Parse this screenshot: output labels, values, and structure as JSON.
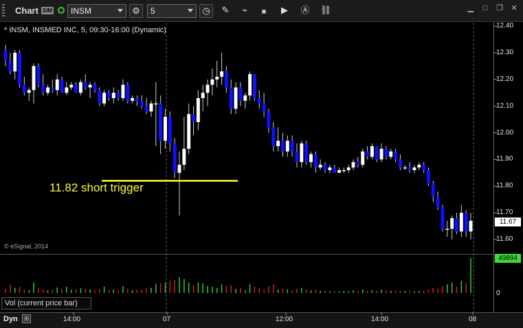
{
  "toolbar": {
    "title": "Chart",
    "sim_badge": "SIM",
    "symbol": "INSM",
    "interval": "5"
  },
  "chart_header": "* INSM, INSMED INC, 5, 09:30-16:00 (Dynamic)",
  "copyright": "© eSignal, 2014",
  "annotation": "11.82 short trigger",
  "volume_label": "Vol (current price bar)",
  "footer": {
    "dyn": "Dyn"
  },
  "current_price": "11.67",
  "current_volume": "49894",
  "volume_zero": "0",
  "colors": {
    "up": "#ffffff",
    "down": "#1010ff",
    "trigger": "#ffff33",
    "vol_up": "#33cc33",
    "vol_down": "#cc2222"
  },
  "chart_data": {
    "type": "candlestick",
    "symbol": "INSM",
    "y_ticks": [
      "12.40",
      "12.30",
      "12.20",
      "12.10",
      "12.00",
      "11.90",
      "11.80",
      "11.70",
      "11.60"
    ],
    "ylim": [
      11.56,
      12.42
    ],
    "x_ticks": [
      "14:00",
      "07",
      "12:00",
      "14:00",
      "08"
    ],
    "trigger_level": 11.82,
    "bars": [
      [
        12.31,
        12.33,
        12.25,
        12.27
      ],
      [
        12.27,
        12.3,
        12.22,
        12.23
      ],
      [
        12.23,
        12.31,
        12.2,
        12.3
      ],
      [
        12.3,
        12.31,
        12.17,
        12.18
      ],
      [
        12.18,
        12.21,
        12.14,
        12.15
      ],
      [
        12.15,
        12.17,
        12.12,
        12.16
      ],
      [
        12.16,
        12.26,
        12.11,
        12.25
      ],
      [
        12.25,
        12.26,
        12.17,
        12.18
      ],
      [
        12.18,
        12.22,
        12.14,
        12.15
      ],
      [
        12.15,
        12.18,
        12.14,
        12.17
      ],
      [
        12.17,
        12.2,
        12.15,
        12.16
      ],
      [
        12.16,
        12.22,
        12.14,
        12.2
      ],
      [
        12.2,
        12.21,
        12.15,
        12.15
      ],
      [
        12.15,
        12.19,
        12.14,
        12.17
      ],
      [
        12.17,
        12.19,
        12.16,
        12.18
      ],
      [
        12.18,
        12.19,
        12.15,
        12.15
      ],
      [
        12.15,
        12.2,
        12.14,
        12.19
      ],
      [
        12.19,
        12.22,
        12.16,
        12.17
      ],
      [
        12.17,
        12.19,
        12.13,
        12.18
      ],
      [
        12.18,
        12.19,
        12.15,
        12.16
      ],
      [
        12.16,
        12.17,
        12.1,
        12.11
      ],
      [
        12.11,
        12.16,
        12.1,
        12.15
      ],
      [
        12.15,
        12.16,
        12.12,
        12.13
      ],
      [
        12.13,
        12.17,
        12.11,
        12.15
      ],
      [
        12.15,
        12.16,
        12.12,
        12.13
      ],
      [
        12.13,
        12.2,
        12.12,
        12.18
      ],
      [
        12.18,
        12.19,
        12.11,
        12.12
      ],
      [
        12.12,
        12.14,
        12.11,
        12.13
      ],
      [
        12.13,
        12.14,
        12.1,
        12.12
      ],
      [
        12.12,
        12.14,
        12.09,
        12.1
      ],
      [
        12.1,
        12.13,
        12.07,
        12.08
      ],
      [
        12.08,
        12.12,
        12.06,
        12.11
      ],
      [
        12.11,
        12.19,
        11.95,
        12.11
      ],
      [
        12.11,
        12.14,
        11.92,
        11.97
      ],
      [
        11.97,
        12.09,
        11.94,
        12.06
      ],
      [
        12.06,
        12.08,
        11.93,
        11.96
      ],
      [
        11.96,
        11.98,
        11.83,
        11.85
      ],
      [
        11.85,
        11.93,
        11.69,
        11.88
      ],
      [
        11.88,
        12.06,
        11.86,
        11.94
      ],
      [
        11.94,
        12.11,
        11.92,
        12.07
      ],
      [
        12.07,
        12.1,
        11.99,
        12.04
      ],
      [
        12.04,
        12.16,
        12.01,
        12.13
      ],
      [
        12.13,
        12.18,
        12.08,
        12.15
      ],
      [
        12.15,
        12.2,
        12.1,
        12.18
      ],
      [
        12.18,
        12.24,
        12.14,
        12.2
      ],
      [
        12.2,
        12.27,
        12.17,
        12.21
      ],
      [
        12.21,
        12.3,
        12.18,
        12.23
      ],
      [
        12.23,
        12.25,
        12.15,
        12.17
      ],
      [
        12.17,
        12.2,
        12.07,
        12.09
      ],
      [
        12.09,
        12.19,
        12.07,
        12.17
      ],
      [
        12.17,
        12.19,
        12.1,
        12.12
      ],
      [
        12.12,
        12.15,
        12.09,
        12.14
      ],
      [
        12.14,
        12.23,
        12.12,
        12.22
      ],
      [
        12.22,
        12.22,
        12.12,
        12.13
      ],
      [
        12.13,
        12.16,
        12.09,
        12.11
      ],
      [
        12.11,
        12.15,
        12.06,
        12.08
      ],
      [
        12.08,
        12.09,
        12.0,
        12.02
      ],
      [
        12.02,
        12.04,
        11.93,
        11.95
      ],
      [
        11.95,
        12.02,
        11.93,
        11.97
      ],
      [
        11.97,
        12.0,
        11.91,
        11.93
      ],
      [
        11.93,
        11.99,
        11.91,
        11.97
      ],
      [
        11.97,
        11.99,
        11.91,
        11.93
      ],
      [
        11.93,
        11.96,
        11.87,
        11.89
      ],
      [
        11.89,
        11.97,
        11.87,
        11.96
      ],
      [
        11.96,
        11.97,
        11.88,
        11.89
      ],
      [
        11.89,
        11.93,
        11.87,
        11.92
      ],
      [
        11.92,
        11.93,
        11.85,
        11.87
      ],
      [
        11.87,
        11.9,
        11.86,
        11.88
      ],
      [
        11.88,
        11.89,
        11.85,
        11.86
      ],
      [
        11.86,
        11.88,
        11.85,
        11.87
      ],
      [
        11.87,
        11.88,
        11.85,
        11.85
      ],
      [
        11.85,
        11.87,
        11.85,
        11.86
      ],
      [
        11.86,
        11.87,
        11.85,
        11.86
      ],
      [
        11.86,
        11.88,
        11.85,
        11.87
      ],
      [
        11.87,
        11.9,
        11.86,
        11.89
      ],
      [
        11.89,
        11.91,
        11.87,
        11.88
      ],
      [
        11.88,
        11.94,
        11.87,
        11.93
      ],
      [
        11.93,
        11.95,
        11.9,
        11.91
      ],
      [
        11.91,
        11.96,
        11.9,
        11.95
      ],
      [
        11.95,
        11.95,
        11.89,
        11.9
      ],
      [
        11.9,
        11.96,
        11.89,
        11.94
      ],
      [
        11.94,
        11.95,
        11.9,
        11.91
      ],
      [
        11.91,
        11.94,
        11.9,
        11.93
      ],
      [
        11.93,
        11.94,
        11.89,
        11.9
      ],
      [
        11.9,
        11.92,
        11.86,
        11.87
      ],
      [
        11.87,
        11.88,
        11.86,
        11.87
      ],
      [
        11.87,
        11.89,
        11.85,
        11.86
      ],
      [
        11.86,
        11.88,
        11.85,
        11.87
      ],
      [
        11.87,
        11.89,
        11.86,
        11.88
      ],
      [
        11.88,
        11.89,
        11.85,
        11.86
      ],
      [
        11.86,
        11.87,
        11.8,
        11.81
      ],
      [
        11.81,
        11.82,
        11.74,
        11.76
      ],
      [
        11.76,
        11.78,
        11.71,
        11.72
      ],
      [
        11.72,
        11.73,
        11.63,
        11.64
      ],
      [
        11.64,
        11.67,
        11.61,
        11.64
      ],
      [
        11.64,
        11.69,
        11.6,
        11.68
      ],
      [
        11.68,
        11.7,
        11.62,
        11.63
      ],
      [
        11.63,
        11.73,
        11.61,
        11.7
      ],
      [
        11.7,
        11.71,
        11.61,
        11.63
      ],
      [
        11.63,
        11.7,
        11.6,
        11.67
      ]
    ],
    "volume_max_label": 49894,
    "volumes": [
      0.12,
      0.25,
      0.15,
      0.18,
      0.1,
      0.08,
      0.3,
      0.14,
      0.12,
      0.08,
      0.1,
      0.16,
      0.12,
      0.18,
      0.09,
      0.1,
      0.14,
      0.12,
      0.1,
      0.08,
      0.12,
      0.18,
      0.09,
      0.1,
      0.07,
      0.2,
      0.12,
      0.08,
      0.1,
      0.09,
      0.14,
      0.15,
      0.25,
      0.28,
      0.3,
      0.35,
      0.38,
      0.45,
      0.4,
      0.3,
      0.22,
      0.3,
      0.28,
      0.2,
      0.18,
      0.15,
      0.25,
      0.2,
      0.22,
      0.12,
      0.15,
      0.08,
      0.25,
      0.18,
      0.15,
      0.1,
      0.2,
      0.25,
      0.1,
      0.12,
      0.1,
      0.08,
      0.12,
      0.15,
      0.1,
      0.08,
      0.1,
      0.06,
      0.08,
      0.05,
      0.06,
      0.05,
      0.06,
      0.05,
      0.08,
      0.06,
      0.1,
      0.06,
      0.08,
      0.07,
      0.1,
      0.08,
      0.06,
      0.07,
      0.08,
      0.06,
      0.07,
      0.05,
      0.06,
      0.08,
      0.1,
      0.15,
      0.12,
      0.2,
      0.25,
      0.3,
      0.18,
      0.35,
      0.28,
      1.0
    ]
  }
}
